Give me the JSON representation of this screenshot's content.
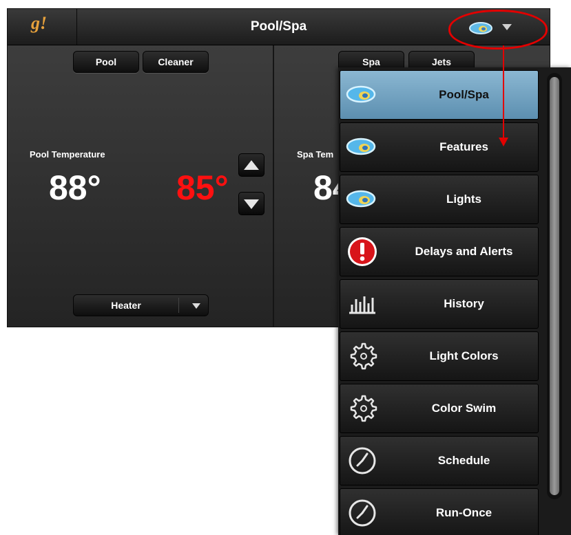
{
  "topbar": {
    "logo_text": "g!",
    "title": "Pool/Spa",
    "nav_icon": "pool-spa-icon",
    "menu_caret_icon": "chevron-down-icon"
  },
  "pool_panel": {
    "tabs": [
      "Pool",
      "Cleaner"
    ],
    "temp_label": "Pool Temperature",
    "current_temp": "88°",
    "set_temp": "85°",
    "heater_select": "Heater"
  },
  "spa_panel": {
    "tabs": [
      "Spa",
      "Jets"
    ],
    "temp_label": "Spa Tem",
    "current_temp": "84"
  },
  "menu": {
    "items": [
      {
        "label": "Pool/Spa",
        "icon": "pool-spa-icon",
        "active": true
      },
      {
        "label": "Features",
        "icon": "pool-spa-icon",
        "active": false
      },
      {
        "label": "Lights",
        "icon": "pool-spa-icon",
        "active": false
      },
      {
        "label": "Delays and Alerts",
        "icon": "alert-icon",
        "active": false
      },
      {
        "label": "History",
        "icon": "history-chart-icon",
        "active": false
      },
      {
        "label": "Light Colors",
        "icon": "gear-icon",
        "active": false
      },
      {
        "label": "Color Swim",
        "icon": "gear-icon",
        "active": false
      },
      {
        "label": "Schedule",
        "icon": "clock-icon",
        "active": false
      },
      {
        "label": "Run-Once",
        "icon": "clock-icon",
        "active": false
      }
    ]
  },
  "colors": {
    "accent_active": "#7aaac8",
    "set_temp": "#ff1010",
    "callout": "#e20000",
    "logo": "#e8a23c"
  }
}
